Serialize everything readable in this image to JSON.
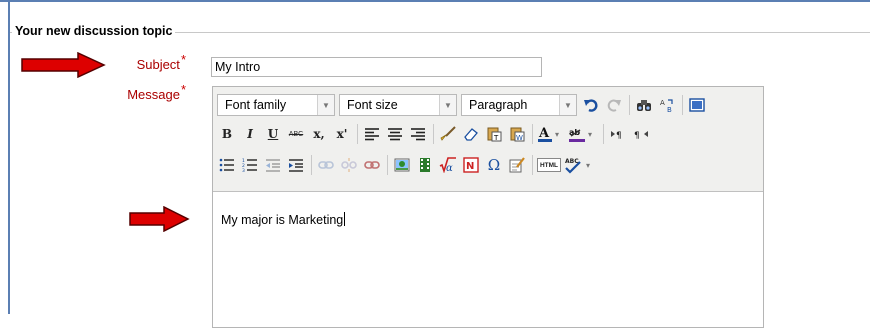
{
  "fieldset": {
    "legend": "Your new discussion topic"
  },
  "form": {
    "subject": {
      "label": "Subject",
      "required_mark": "*",
      "value": "My Intro"
    },
    "message": {
      "label": "Message",
      "required_mark": "*"
    }
  },
  "editor": {
    "font_family": "Font family",
    "font_size": "Font size",
    "format": "Paragraph",
    "content": "My major is Marketing",
    "toolbar": {
      "bold": "B",
      "italic": "I",
      "underline": "U",
      "strikethrough": "ABC",
      "subscript": "x,",
      "superscript": "x'",
      "html": "HTML",
      "omega": "Ω"
    }
  },
  "colors": {
    "label": "#aa0000",
    "arrow": "#dd0000",
    "frame": "#5b7fb3"
  }
}
